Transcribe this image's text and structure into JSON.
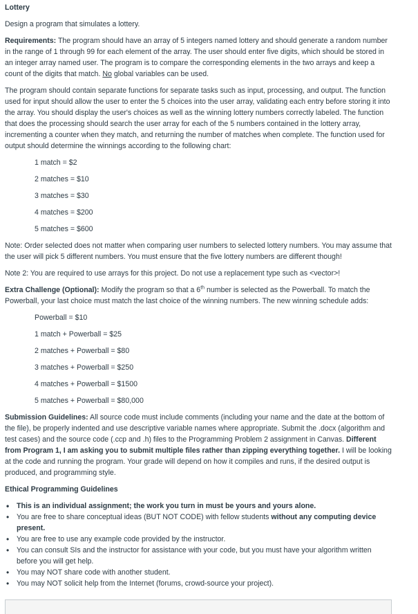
{
  "title": "Lottery",
  "intro": "Design a program that simulates a lottery.",
  "requirements": {
    "label": "Requirements:",
    "text": "The program should have an array of 5 integers named lottery and should generate a random number in the range of 1 through 99 for each element of the array.  The user should enter five digits, which should be stored in an integer array named user.  The program is to compare the corresponding elements in the two arrays and keep a count of the digits that match.",
    "no": "No",
    "tail": "global variables can be used."
  },
  "functions_paragraph": "The program should contain separate functions for separate tasks such as input, processing, and output.  The function used for input should allow the user to enter the 5 choices into the user array, validating each entry before storing it into the array.  You should display the user's choices as well as the winning lottery numbers correctly labeled.  The function that does the processing should search the user array for each of the 5 numbers contained in the lottery array, incrementing a counter when they match, and returning the number of matches when complete. The function used for output should determine the winnings according to the following chart:",
  "chart": [
    "1 match = $2",
    "2 matches = $10",
    "3 matches = $30",
    "4 matches = $200",
    "5 matches = $600"
  ],
  "note1": "Note: Order selected does not matter when comparing user numbers to selected lottery numbers.  You may assume that the user will pick 5 different numbers. You must ensure that the five lottery numbers are different though!",
  "note2": "Note 2: You are required to use arrays for this project. Do not use a replacement type such as <vector>!",
  "extra": {
    "label": "Extra Challenge (Optional):",
    "text1": "Modify the program so that a 6",
    "sup": "th",
    "text2": "number is selected as the Powerball.  To match the Powerball, your last choice must match the last choice of the winning numbers.  The new winning schedule adds:"
  },
  "powerball_chart": [
    "Powerball = $10",
    "1 match + Powerball = $25",
    "2 matches + Powerball = $80",
    "3 matches + Powerball = $250",
    "4 matches + Powerball = $1500",
    "5 matches + Powerball = $80,000"
  ],
  "submission": {
    "label": "Submission Guidelines:",
    "text": "All source code must include comments (including your name and the date at the bottom of the file), be properly indented and use descriptive variable names where appropriate. Submit the .docx (algorithm and test cases) and the source code (.ccp and .h) files to the Programming Problem 2 assignment in Canvas.",
    "bold": "Different from Program 1, I am asking you to submit multiple files rather than zipping everything together.",
    "text2": "I will be looking at the code and running the program.  Your grade will depend on how it compiles and runs, if the desired output is produced, and programming style."
  },
  "ethics": {
    "heading": "Ethical Programming Guidelines",
    "item1": "This is an individual assignment; the work you turn in must be yours and yours alone.",
    "item2_a": "You are free to share conceptual ideas (BUT NOT CODE) with fellow students",
    "item2_b": "without any computing device present.",
    "item3": "You are free to use any example code provided by the instructor.",
    "item4": "You can consult SIs and the instructor for assistance with your code, but you must have your algorithm written before you will get help.",
    "item5": "You may NOT share code with another student.",
    "item6": "You may NOT solicit help from the Internet (forums, crowd-source your project)."
  }
}
